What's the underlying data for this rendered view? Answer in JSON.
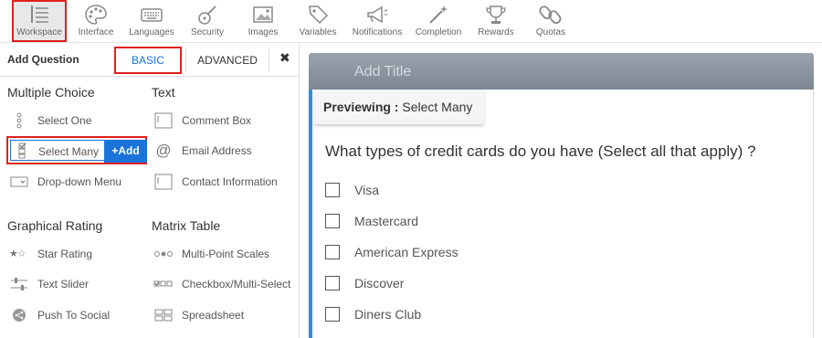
{
  "toolbar": {
    "items": [
      {
        "label": "Workspace",
        "icon": "workspace-icon",
        "active": true
      },
      {
        "label": "Interface",
        "icon": "palette-icon"
      },
      {
        "label": "Languages",
        "icon": "keyboard-icon"
      },
      {
        "label": "Security",
        "icon": "guitar-icon"
      },
      {
        "label": "Images",
        "icon": "image-icon"
      },
      {
        "label": "Variables",
        "icon": "tag-icon"
      },
      {
        "label": "Notifications",
        "icon": "megaphone-icon"
      },
      {
        "label": "Completion",
        "icon": "magic-wand-icon"
      },
      {
        "label": "Rewards",
        "icon": "trophy-icon"
      },
      {
        "label": "Quotas",
        "icon": "chain-link-icon"
      }
    ]
  },
  "panel": {
    "header": "Add Question",
    "tab_basic": "BASIC",
    "tab_advanced": "ADVANCED",
    "close": "✖"
  },
  "sections": {
    "multiple_choice": {
      "title": "Multiple Choice",
      "items": [
        "Select One",
        "Select Many",
        "Drop-down Menu"
      ],
      "add_label": "+Add"
    },
    "text": {
      "title": "Text",
      "items": [
        "Comment Box",
        "Email Address",
        "Contact Information"
      ]
    },
    "graphical_rating": {
      "title": "Graphical Rating",
      "items": [
        "Star Rating",
        "Text Slider",
        "Push To Social"
      ]
    },
    "matrix_table": {
      "title": "Matrix Table",
      "items": [
        "Multi-Point Scales",
        "Checkbox/Multi-Select",
        "Spreadsheet"
      ]
    }
  },
  "preview": {
    "title_placeholder": "Add Title",
    "badge_label": "Previewing :",
    "badge_value": "Select Many",
    "question": "What types of credit cards do you have (Select all that apply) ?",
    "options": [
      "Visa",
      "Mastercard",
      "American Express",
      "Discover",
      "Diners Club"
    ]
  },
  "colors": {
    "accent": "#1a73d9",
    "highlight": "#e02020",
    "preview_border": "#2a8ee8"
  }
}
